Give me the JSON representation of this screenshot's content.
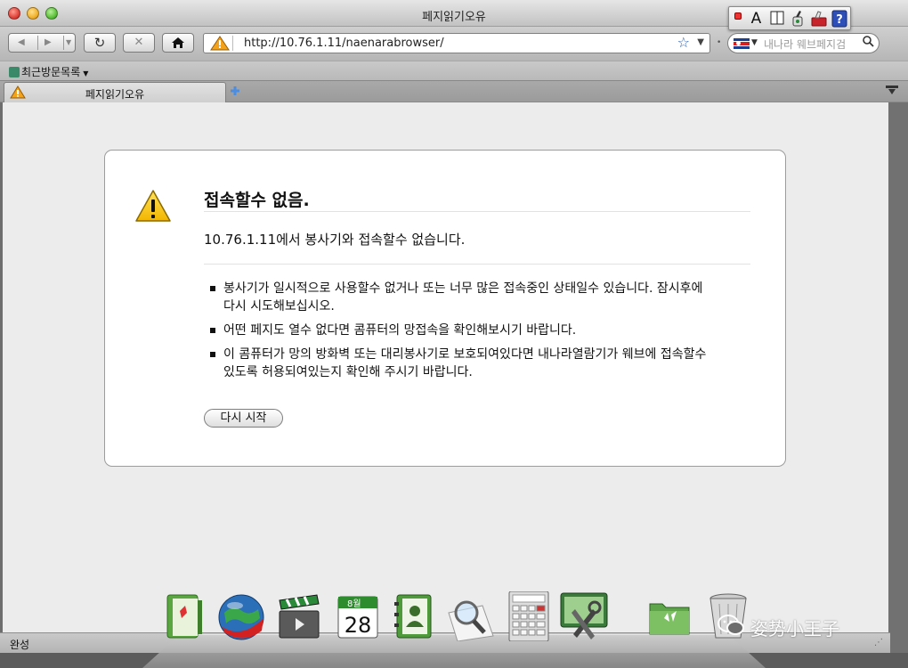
{
  "window": {
    "title": "페지읽기오유"
  },
  "input_palette": {
    "icons": [
      "record-icon",
      "font-icon",
      "columns-icon",
      "brush-icon",
      "toolbox-icon",
      "help-icon"
    ],
    "font_glyph": "A",
    "help_glyph": "?"
  },
  "toolbar": {
    "back_glyph": "◀",
    "forward_glyph": "▶",
    "reload_glyph": "↻",
    "stop_glyph": "✕",
    "home_glyph": "⌂",
    "url": "http://10.76.1.11/naenarabrowser/",
    "search_placeholder": "내나라 웨브페지검"
  },
  "bookmarks": {
    "folder_label": "최근방문목록"
  },
  "tabs": [
    {
      "label": "페지읽기오유",
      "active": true
    }
  ],
  "error_page": {
    "title": "접속할수 없음.",
    "description": "10.76.1.11에서 봉사기와 접속할수 없습니다.",
    "bullets": [
      "봉사기가 일시적으로 사용할수 없거나 또는 너무 많은 접속중인 상태일수 있습니다. 잠시후에 다시 시도해보십시오.",
      "어떤 페지도 열수 없다면 콤퓨터의 망접속을 확인해보시기 바랍니다.",
      "이 콤퓨터가 망의 방화벽 또는 대리봉사기로 보호되여있다면 내나라열람기가 웨브에 접속할수 있도록 허용되여있는지 확인해 주시기 바랍니다."
    ],
    "retry_label": "다시 시작"
  },
  "status_bar": {
    "text": "완성"
  },
  "dock": {
    "calendar_month": "8월",
    "calendar_day": "28",
    "items": [
      "notes-app-icon",
      "globe-browser-icon",
      "video-clapper-icon",
      "calendar-icon",
      "address-book-icon",
      "magnifier-preview-icon",
      "calculator-icon",
      "system-tools-icon",
      "folder-icon",
      "trash-icon"
    ]
  },
  "watermark": {
    "text": "姿势小王子"
  },
  "colors": {
    "warning_yellow": "#f4c20d",
    "accent_blue": "#2d5fa8",
    "content_bg": "#ececec"
  }
}
